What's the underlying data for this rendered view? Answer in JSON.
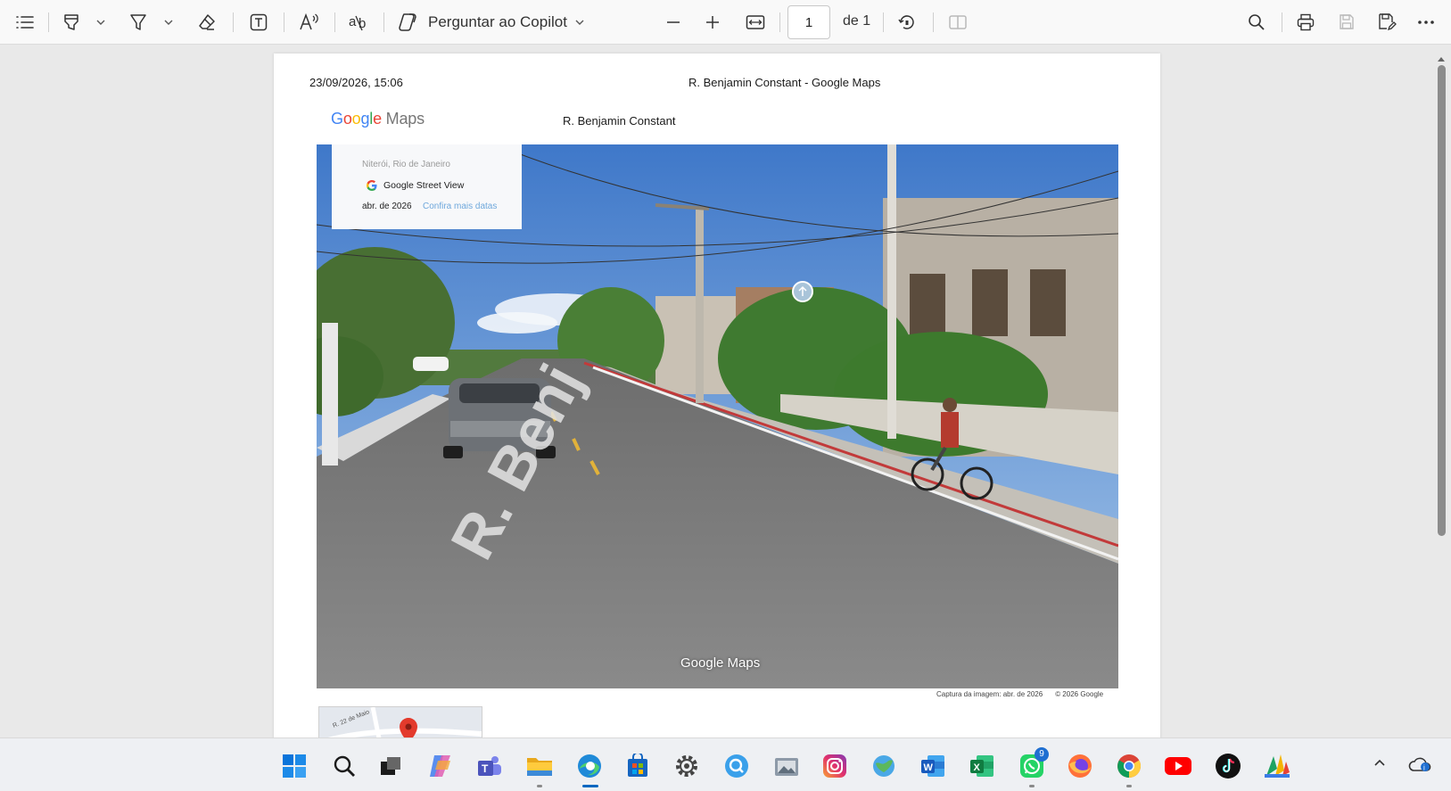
{
  "toolbar": {
    "copilot_label": "Perguntar ao Copilot",
    "page_current": "1",
    "page_of": "de 1"
  },
  "page": {
    "header_date": "23/09/2026, 15:06",
    "header_title": "R. Benjamin Constant - Google Maps",
    "gmaps_logo": [
      "G",
      "o",
      "o",
      "g",
      "l",
      "e",
      " Maps"
    ],
    "street_name": "R. Benjamin Constant",
    "streetview_card": {
      "location": "Niterói, Rio de Janeiro",
      "brand": "Google Street View",
      "date": "abr. de 2026",
      "more_dates": "Confira mais datas"
    },
    "road_label": "R. Benj",
    "watermark": "Google Maps",
    "caption_capture": "Captura da imagem: abr. de 2026",
    "caption_copyright": "© 2026 Google",
    "minimap_label": "R. 22 de Maio"
  },
  "taskbar": {
    "badge_count": "9"
  },
  "colors": {
    "accent": "#0067c0",
    "google_blue": "#4285F4",
    "google_red": "#EA4335",
    "google_yellow": "#FBBC05",
    "google_green": "#34A853"
  },
  "icons": {
    "toolbar": [
      "contents-list-icon",
      "highlighter-icon",
      "chevron-down-icon",
      "draw-icon",
      "chevron-down-icon",
      "eraser-icon",
      "text-box-icon",
      "read-aloud-icon",
      "translate-icon",
      "copilot-icon",
      "chevron-down-icon",
      "zoom-out-icon",
      "zoom-in-icon",
      "fit-width-icon",
      "rotate-icon",
      "two-page-view-icon",
      "search-icon",
      "print-icon",
      "save-icon",
      "save-as-icon",
      "more-icon"
    ],
    "taskbar": [
      "windows-start-icon",
      "search-icon",
      "task-view-icon",
      "copilot-app-icon",
      "teams-icon",
      "file-explorer-icon",
      "edge-icon",
      "microsoft-store-icon",
      "settings-icon",
      "edge-search-icon",
      "photos-icon",
      "instagram-icon",
      "weather-icon",
      "word-icon",
      "excel-icon",
      "whatsapp-icon",
      "firefox-icon",
      "chrome-icon",
      "youtube-icon",
      "tiktok-icon",
      "app-icon"
    ]
  }
}
